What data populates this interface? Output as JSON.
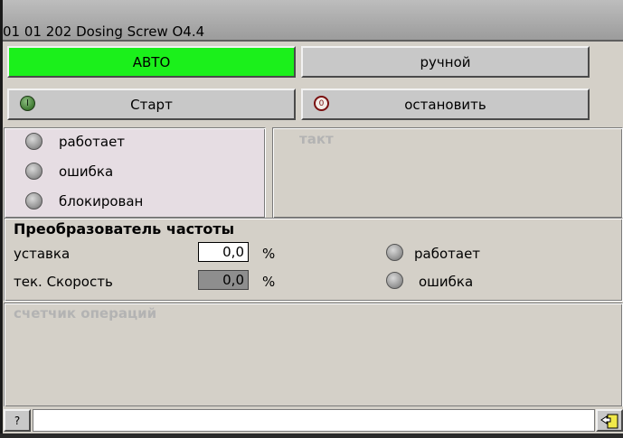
{
  "window": {
    "title": "01  01  202 Dosing Screw O4.4"
  },
  "mode": {
    "auto_label": "АВТО",
    "manual_label": "ручной",
    "auto_color": "#1bf01b"
  },
  "control": {
    "start_label": "Старт",
    "start_icon_glyph": "I",
    "stop_label": "остановить",
    "stop_icon_glyph": "0"
  },
  "status": {
    "running": "работает",
    "error": "ошибка",
    "blocked": "блокирован"
  },
  "cycle": {
    "title": "такт"
  },
  "frequency_converter": {
    "title": "Преобразователь частоты",
    "setpoint_label": "уставка",
    "setpoint_value": "0,0",
    "setpoint_unit": "%",
    "speed_label": "тек. Скорость",
    "speed_value": "0,0",
    "speed_unit": "%",
    "running": "работает",
    "error": "ошибка"
  },
  "counter": {
    "title": "счетчик операций"
  },
  "statusbar": {
    "help_label": "?",
    "message": ""
  }
}
